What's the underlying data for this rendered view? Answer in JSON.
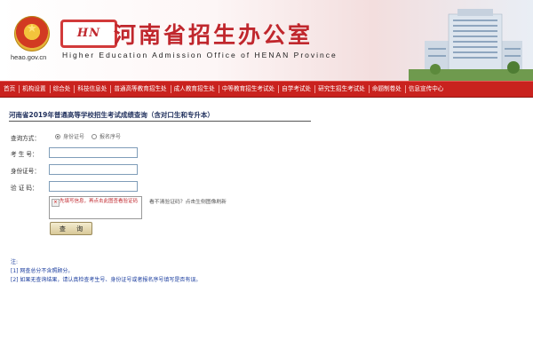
{
  "header": {
    "site_url": "heao.gov.cn",
    "logo_badge": "HN",
    "title": "河南省招生办公室",
    "subtitle_en": "Higher Education Admission Office of HENAN Province"
  },
  "nav": {
    "items": [
      "首页",
      "机构设置",
      "综合处",
      "科技信息处",
      "普通高等教育招生处",
      "成人教育招生处",
      "中等教育招生考试处",
      "自学考试处",
      "研究生招生考试处",
      "命题制卷处",
      "信息宣传中心"
    ]
  },
  "main": {
    "heading": "河南省2019年普通高等学校招生考试成绩查询（含对口生和专升本）",
    "query_mode": {
      "label": "查询方式：",
      "options": [
        "身份证号",
        "报名序号"
      ],
      "selected": "身份证号"
    },
    "fields": {
      "exam_number_label": "考 生 号：",
      "id_number_label": "身份证号：",
      "captcha_label": "验 证 码："
    },
    "captcha": {
      "alt_text": "先填写信息，再点击此图查看验证码"
    },
    "refresh_hint": "看不清验证码？点击生侧图像刷新",
    "query_button": "查 询"
  },
  "notes": {
    "title": "注:",
    "items": [
      "[1]  网查总分不含照顾分。",
      "[2]  如果无查询结果，请认真检查考生号、身份证号或者报名序号填写是否有误。"
    ]
  }
}
